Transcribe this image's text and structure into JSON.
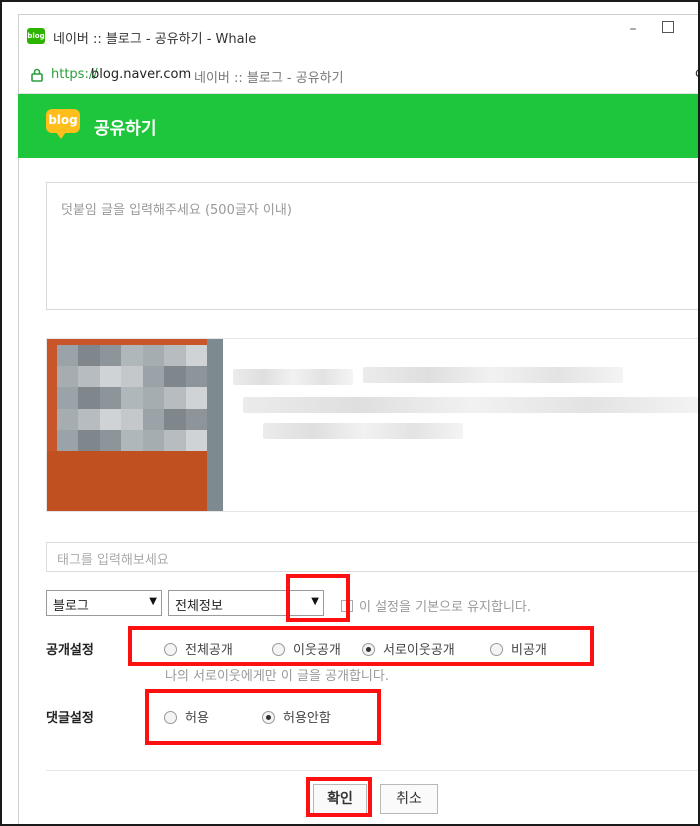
{
  "window": {
    "title": "네이버 :: 블로그 - 공유하기 - Whale",
    "icon_text": "blog",
    "minimize_glyph": "–"
  },
  "address_bar": {
    "scheme": "https://",
    "host": "blog.naver.com",
    "page_title": "네이버 :: 블로그 - 공유하기",
    "edge_glyph": "c"
  },
  "header": {
    "logo_text": "blog",
    "title": "공유하기",
    "accent_color": "#1ec63c"
  },
  "comment": {
    "placeholder": "덧붙임 글을 입력해주세요 (500글자 이내)"
  },
  "tags": {
    "placeholder": "태그를 입력해보세요"
  },
  "category_select": {
    "value": "블로그"
  },
  "info_select": {
    "value": "전체정보"
  },
  "keep_default": {
    "label": "이 설정을 기본으로 유지합니다."
  },
  "visibility": {
    "label": "공개설정",
    "options": [
      {
        "label": "전체공개",
        "checked": false
      },
      {
        "label": "이웃공개",
        "checked": false
      },
      {
        "label": "서로이웃공개",
        "checked": true
      },
      {
        "label": "비공개",
        "checked": false
      }
    ],
    "helper": "나의 서로이웃에게만 이 글을 공개합니다."
  },
  "comments_setting": {
    "label": "댓글설정",
    "options": [
      {
        "label": "허용",
        "checked": false
      },
      {
        "label": "허용안함",
        "checked": true
      }
    ]
  },
  "buttons": {
    "ok": "확인",
    "cancel": "취소"
  },
  "highlight_color": "#ff1010"
}
